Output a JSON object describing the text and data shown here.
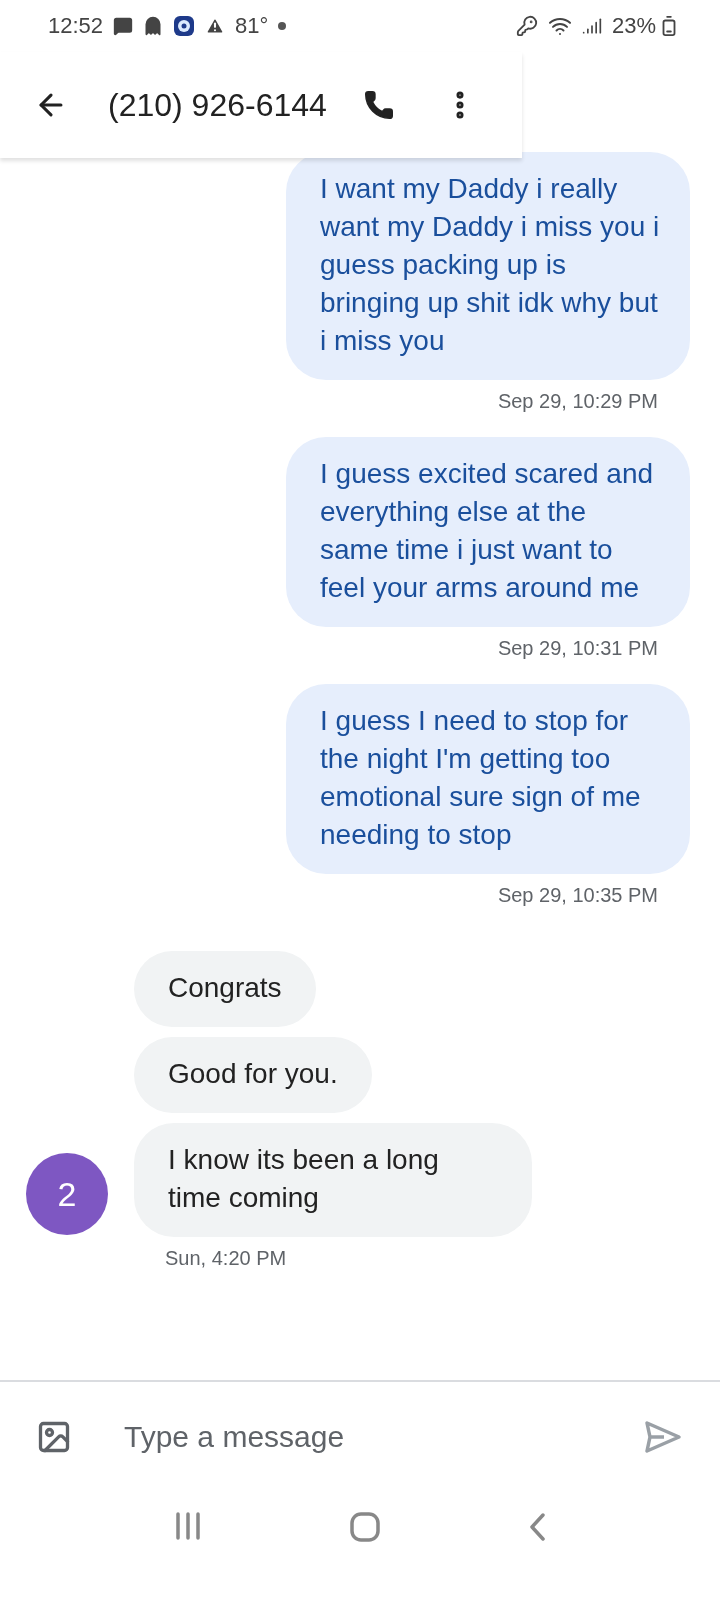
{
  "status_bar": {
    "time": "12:52",
    "temperature": "81°",
    "battery": "23%"
  },
  "header": {
    "title": "(210) 926-6144"
  },
  "messages": [
    {
      "kind": "outgoing",
      "text": "I want my Daddy i really want my Daddy i miss you i guess packing up is bringing up shit idk why but i miss you",
      "time": "Sep 29, 10:29 PM"
    },
    {
      "kind": "outgoing",
      "text": "I guess excited scared and everything else at the same time i just want to feel your arms around me",
      "time": "Sep 29, 10:31 PM"
    },
    {
      "kind": "outgoing",
      "text": "I guess I need to stop for the night I'm getting too emotional sure sign of me needing to stop",
      "time": "Sep 29, 10:35 PM"
    },
    {
      "kind": "incoming",
      "text": "Congrats"
    },
    {
      "kind": "incoming",
      "text": "Good for you."
    },
    {
      "kind": "incoming",
      "text": "I know its been a long time coming",
      "avatar": "2",
      "color": "#7e57c2",
      "time": "Sun, 4:20 PM"
    }
  ],
  "composer": {
    "placeholder": "Type a message"
  }
}
